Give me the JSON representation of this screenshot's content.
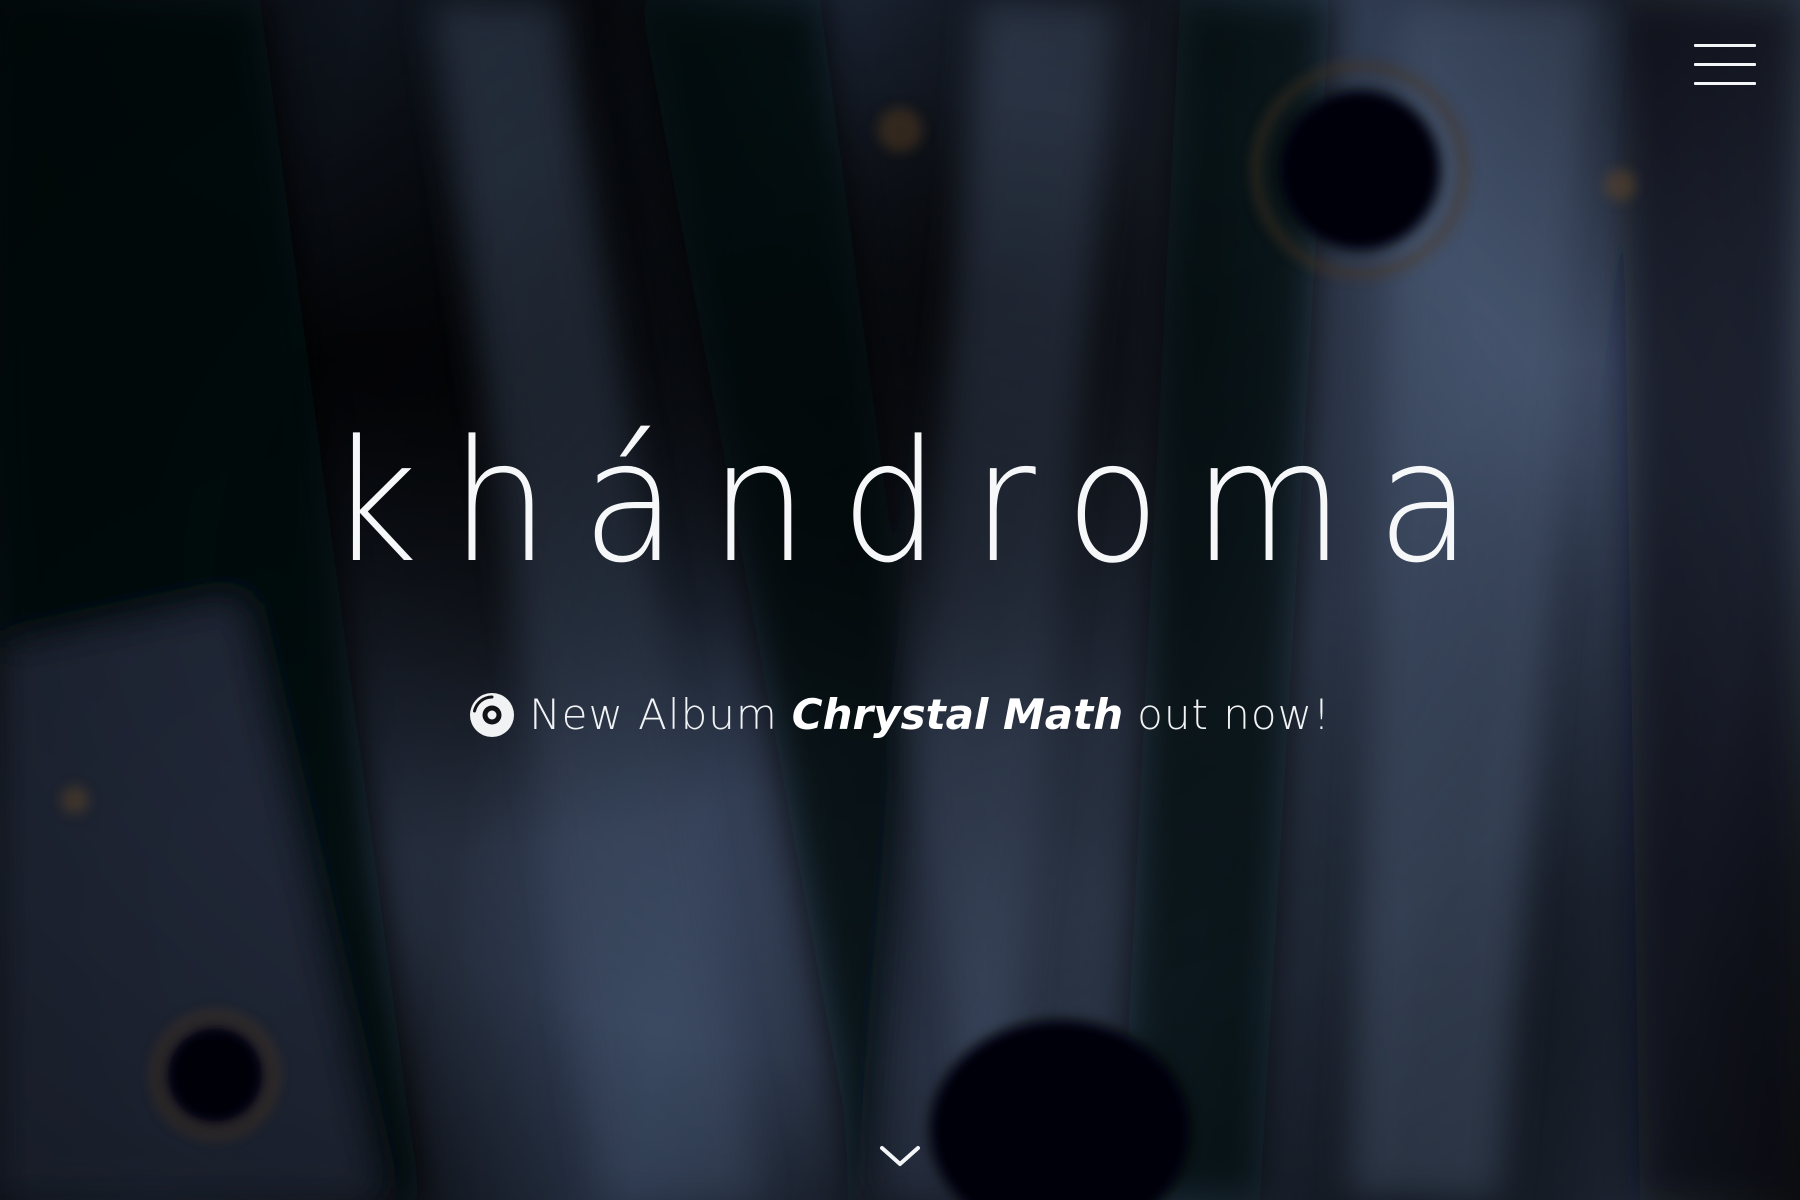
{
  "hero": {
    "title": "khándroma",
    "announcement": {
      "prefix": "New Album",
      "album_name": "Chrystal Math",
      "suffix": "out now!"
    }
  },
  "icons": {
    "menu": "hamburger-menu-icon",
    "announcement": "vinyl-disc-icon",
    "scroll": "chevron-down-icon"
  },
  "colors": {
    "text": "#f4f5f7",
    "background_dark": "#05070b",
    "background_blue": "#3d4d68"
  }
}
